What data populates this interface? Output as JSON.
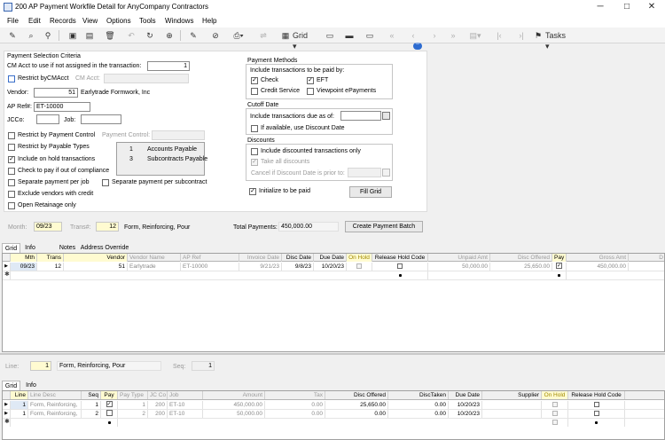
{
  "window": {
    "title": "200 AP Payment Workfile Detail for AnyCompany Contractors",
    "minimize": "─",
    "maximize": "□",
    "close": "✕"
  },
  "menu": [
    "File",
    "Edit",
    "Records",
    "View",
    "Options",
    "Tools",
    "Windows",
    "Help"
  ],
  "toolbar": {
    "grid_label": "Grid",
    "tasks_label": "Tasks"
  },
  "criteria": {
    "title": "Payment Selection Criteria",
    "cm_acct_label": "CM Acct to use if not assigned in the transaction:",
    "cm_acct_value": "1",
    "restrict_cmacct_label": "Restrict byCMAcct",
    "cm_acct_short_label": "CM Acct:",
    "vendor_label": "Vendor:",
    "vendor_value": "51",
    "vendor_name": "Earlytrade Formwork, Inc",
    "apref_label": "AP Ref#:",
    "apref_value": "ET-10000",
    "jcco_label": "JCCo:",
    "job_label": "Job:",
    "restrict_payment_control_label": "Restrict by Payment Control",
    "payment_control_label": "Payment Control:",
    "restrict_payable_types_label": "Restrict by Payable Types",
    "include_on_hold_label": "Include on hold transactions",
    "check_pay_label": "Check to pay if out of compliance",
    "separate_per_job_label": "Separate payment per job",
    "separate_per_subcontract_label": "Separate payment per subcontract",
    "exclude_vendors_label": "Exclude vendors with credit",
    "open_retainage_label": "Open Retainage only",
    "payable_types": [
      {
        "code": "1",
        "name": "Accounts Payable"
      },
      {
        "code": "3",
        "name": "Subcontracts Payable"
      }
    ]
  },
  "methods": {
    "title": "Payment Methods",
    "include_label": "Include transactions to be paid by:",
    "check_label": "Check",
    "eft_label": "EFT",
    "credit_service_label": "Credit Service",
    "viewpoint_label": "Viewpoint ePayments"
  },
  "cutoff": {
    "title": "Cutoff Date",
    "due_label": "Include transactions due as of:",
    "discount_label": "If available, use Discount Date"
  },
  "discounts": {
    "title": "Discounts",
    "include_discounted_label": "Include discounted transactions only",
    "take_all_label": "Take all discounts",
    "cancel_label": "Cancel if Discount Date is prior to:"
  },
  "initialize_label": "Initialize to be paid",
  "fill_grid_label": "Fill Grid",
  "batch": {
    "month_label": "Month:",
    "month_value": "09/23",
    "trans_label": "Trans#:",
    "trans_value": "12",
    "trans_desc": "Form, Reinforcing, Pour",
    "total_label": "Total Payments:",
    "total_value": "450,000.00",
    "create_label": "Create Payment Batch"
  },
  "top_tabs": [
    "Grid",
    "Info",
    "Notes",
    "Address Override"
  ],
  "top_grid": {
    "headers": [
      "Mth",
      "Trans",
      "Vendor",
      "Vendor Name",
      "AP Ref",
      "Invoice Date",
      "Disc Date",
      "Due Date",
      "On Hold",
      "Release Hold Code",
      "Unpaid Amt",
      "Disc Offered",
      "Pay",
      "Gross Amt",
      "D"
    ],
    "row": {
      "mth": "09/23",
      "trans": "12",
      "vendor": "51",
      "vendor_name": "Earlytrade",
      "ap_ref": "ET-10000",
      "invoice_date": "9/21/23",
      "disc_date": "9/8/23",
      "due_date": "10/20/23",
      "unpaid_amt": "50,000.00",
      "disc_offered": "25,650.00",
      "pay": "✓",
      "gross_amt": "450,000.00"
    },
    "current_marker": "▶",
    "new_marker": "✱"
  },
  "line": {
    "line_label": "Line:",
    "line_value": "1",
    "line_desc": "Form, Reinforcing, Pour",
    "seq_label": "Seq:",
    "seq_value": "1"
  },
  "bottom_tabs": [
    "Grid",
    "Info"
  ],
  "bottom_grid": {
    "headers": [
      "Line",
      "Line Desc",
      "Seq",
      "Pay",
      "Pay Type",
      "JC Co",
      "Job",
      "Amount",
      "Tax",
      "Disc Offered",
      "DiscTaken",
      "Due Date",
      "Supplier",
      "On Hold",
      "Release Hold Code"
    ],
    "rows": [
      {
        "line": "1",
        "desc": "Form, Reinforcing,",
        "seq": "1",
        "pay": "✓",
        "pay_type": "1",
        "jcco": "200",
        "job": "ET-10",
        "amount": "450,000.00",
        "tax": "0.00",
        "disc_offered": "25,650.00",
        "disc_taken": "0.00",
        "due_date": "10/20/23"
      },
      {
        "line": "1",
        "desc": "Form, Reinforcing,",
        "seq": "2",
        "pay": "",
        "pay_type": "2",
        "jcco": "200",
        "job": "ET-10",
        "amount": "50,000.00",
        "tax": "0.00",
        "disc_offered": "0.00",
        "disc_taken": "0.00",
        "due_date": "10/20/23"
      }
    ]
  }
}
